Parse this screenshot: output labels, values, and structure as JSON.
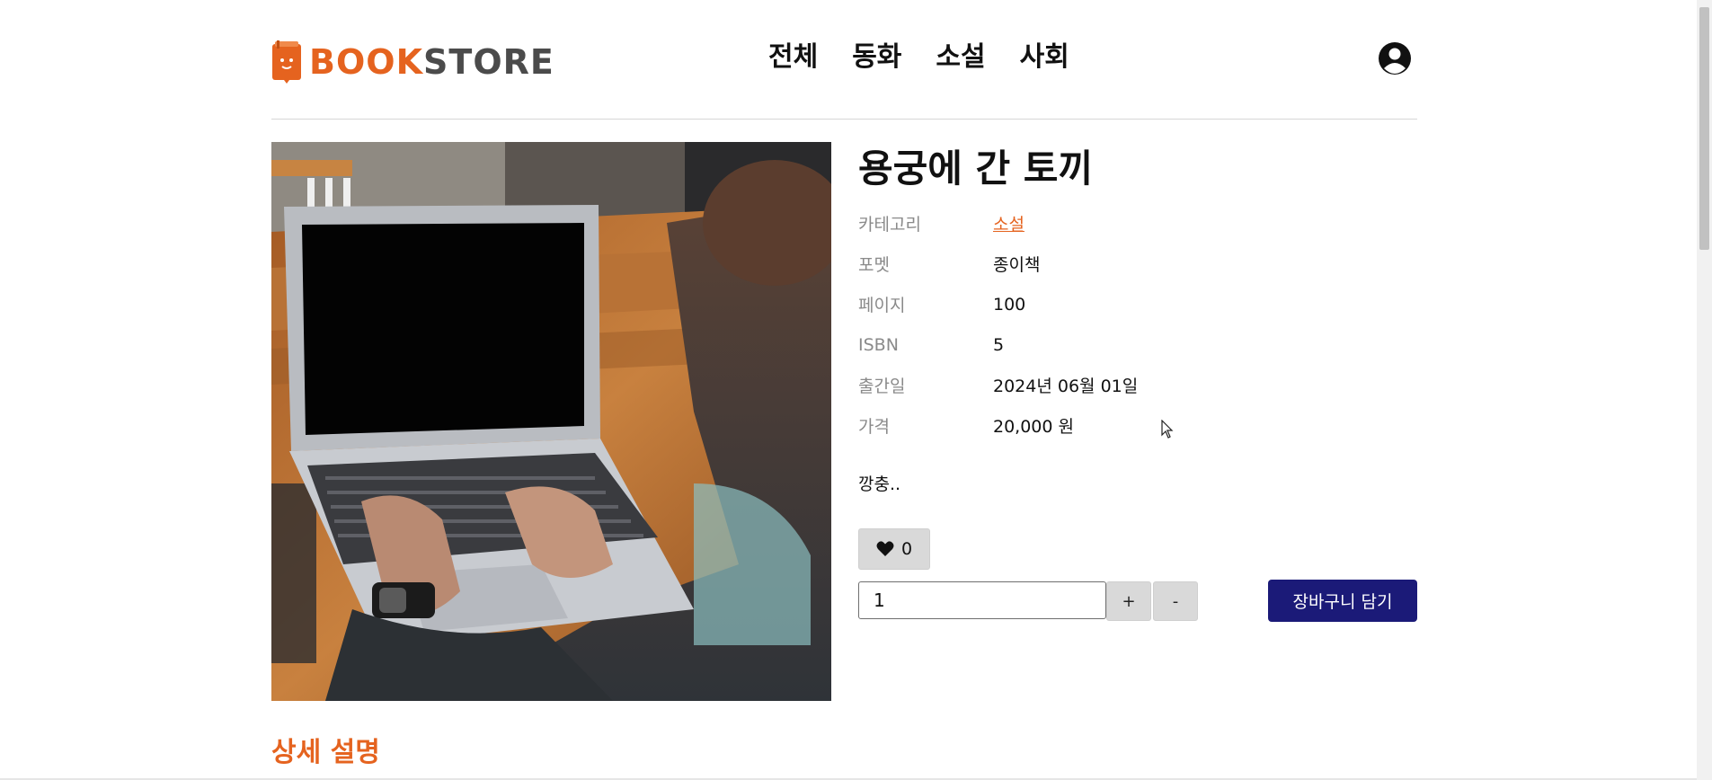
{
  "header": {
    "logo": {
      "book": "BOOK",
      "store": "STORE"
    },
    "nav": [
      {
        "label": "전체"
      },
      {
        "label": "동화"
      },
      {
        "label": "소설"
      },
      {
        "label": "사회"
      }
    ],
    "user_icon": "user-circle-icon"
  },
  "book": {
    "title": "용궁에 간 토끼",
    "details": [
      {
        "label": "카테고리",
        "value": "소설"
      },
      {
        "label": "포멧",
        "value": "종이책"
      },
      {
        "label": "페이지",
        "value": "100"
      },
      {
        "label": "ISBN",
        "value": "5"
      },
      {
        "label": "출간일",
        "value": "2024년 06월 01일"
      },
      {
        "label": "가격",
        "value": "20,000 원"
      }
    ],
    "summary": "깡충..",
    "likes": "0",
    "quantity": "1",
    "plus_label": "+",
    "minus_label": "-",
    "cart_label": "장바구니 담기"
  },
  "section": {
    "detail_title": "상세 설명"
  },
  "colors": {
    "brand": "#e5631f",
    "cart_button": "#1b1a78",
    "label": "#8a8a8a"
  }
}
